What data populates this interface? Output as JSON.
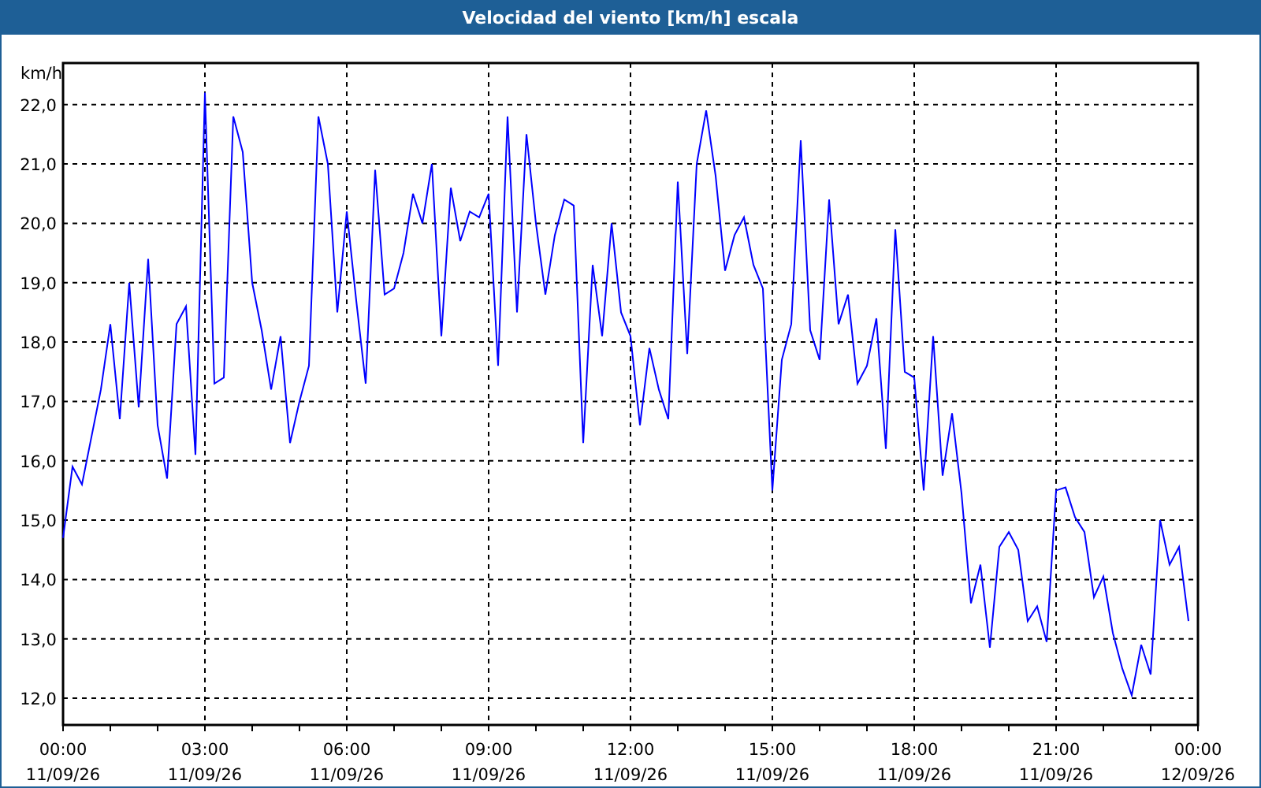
{
  "window": {
    "title": "Velocidad del viento [km/h] escala"
  },
  "chart": {
    "chart_data": {
      "type": "line",
      "grid": true,
      "ylabel": "km/h",
      "ylim": [
        11.55,
        22.7
      ],
      "yticks": [
        {
          "value": 12,
          "label": "12,0"
        },
        {
          "value": 13,
          "label": "13,0"
        },
        {
          "value": 14,
          "label": "14,0"
        },
        {
          "value": 15,
          "label": "15,0"
        },
        {
          "value": 16,
          "label": "16,0"
        },
        {
          "value": 17,
          "label": "17,0"
        },
        {
          "value": 18,
          "label": "18,0"
        },
        {
          "value": 19,
          "label": "19,0"
        },
        {
          "value": 20,
          "label": "20,0"
        },
        {
          "value": 21,
          "label": "21,0"
        },
        {
          "value": 22,
          "label": "22,0"
        }
      ],
      "categories": [
        "00:00\n11/09/26",
        null,
        null,
        null,
        null,
        null,
        null,
        null,
        null,
        null,
        null,
        null,
        null,
        null,
        null,
        "03:00\n11/09/26",
        null,
        null,
        null,
        null,
        null,
        null,
        null,
        null,
        null,
        null,
        null,
        null,
        null,
        null,
        "06:00\n11/09/26",
        null,
        null,
        null,
        null,
        null,
        null,
        null,
        null,
        null,
        null,
        null,
        null,
        null,
        null,
        "09:00\n11/09/26",
        null,
        null,
        null,
        null,
        null,
        null,
        null,
        null,
        null,
        null,
        null,
        null,
        null,
        null,
        "12:00\n11/09/26",
        null,
        null,
        null,
        null,
        null,
        null,
        null,
        null,
        null,
        null,
        null,
        null,
        null,
        null,
        "15:00\n11/09/26",
        null,
        null,
        null,
        null,
        null,
        null,
        null,
        null,
        null,
        null,
        null,
        null,
        null,
        null,
        "18:00\n11/09/26",
        null,
        null,
        null,
        null,
        null,
        null,
        null,
        null,
        null,
        null,
        null,
        null,
        null,
        null,
        "21:00\n11/09/26",
        null,
        null,
        null,
        null,
        null,
        null,
        null,
        null,
        null,
        null,
        null,
        null,
        null,
        null,
        "00:00\n12/09/26"
      ],
      "series": [
        {
          "color": "#0000ff",
          "values": [
            14.7,
            15.9,
            15.6,
            16.4,
            17.2,
            18.3,
            16.7,
            19.0,
            16.9,
            19.4,
            16.6,
            15.7,
            18.3,
            18.6,
            16.1,
            22.2,
            17.3,
            17.4,
            21.8,
            21.2,
            19.0,
            18.2,
            17.2,
            18.1,
            16.3,
            17.0,
            17.6,
            21.8,
            21.0,
            18.5,
            20.2,
            18.7,
            17.3,
            20.9,
            18.8,
            18.9,
            19.5,
            20.5,
            20.0,
            21.0,
            18.1,
            20.6,
            19.7,
            20.2,
            20.1,
            20.5,
            17.6,
            21.8,
            18.5,
            21.5,
            20.0,
            18.8,
            19.8,
            20.4,
            20.3,
            16.3,
            19.3,
            18.1,
            20.0,
            18.5,
            18.1,
            16.6,
            17.9,
            17.2,
            16.7,
            20.7,
            17.8,
            21.0,
            21.9,
            20.8,
            19.2,
            19.8,
            20.1,
            19.3,
            18.9,
            15.5,
            17.7,
            18.3,
            21.4,
            18.2,
            17.7,
            20.4,
            18.3,
            18.8,
            17.3,
            17.6,
            18.4,
            16.2,
            19.9,
            17.5,
            17.4,
            15.5,
            18.1,
            15.75,
            16.8,
            15.45,
            13.6,
            14.25,
            12.85,
            14.55,
            14.8,
            14.5,
            13.3,
            13.55,
            12.95,
            15.5,
            15.55,
            15.05,
            14.8,
            13.7,
            14.05,
            13.1,
            12.5,
            12.05,
            12.9,
            12.4,
            15.0,
            14.25,
            14.55,
            13.3,
            null
          ]
        }
      ]
    }
  }
}
